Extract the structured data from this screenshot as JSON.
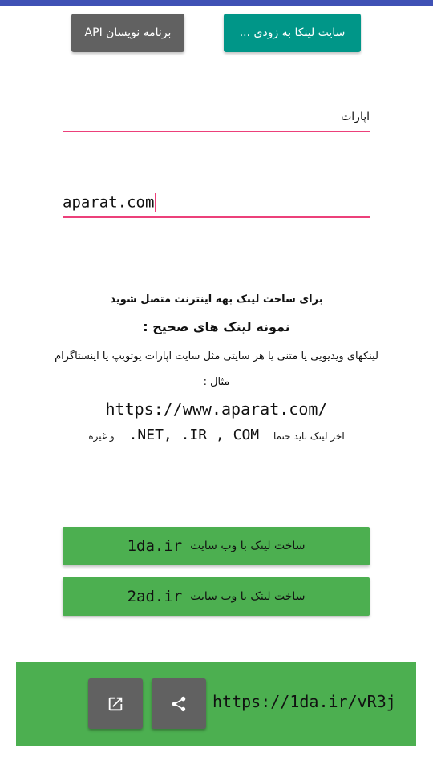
{
  "top_buttons": {
    "api_label": "برنامه نویسان API",
    "coming_soon_label": "سایت لینکا به زودی ..."
  },
  "form": {
    "name_value": "اپارات",
    "url_value": "aparat.com"
  },
  "info": {
    "line1": "برای ساخت لینک بهه اینترنت متصل شوید",
    "line2": "نمونه لینک های صحیح :",
    "line3": "لینکهای ویدیویی یا متنی یا هر سایتی مثل سایت اپارات یوتویپ یا اینستاگرام",
    "line4": "مثال :",
    "example_url": "https://www.aparat.com/",
    "line6_prefix": "اخر لینک باید حتما",
    "line6_ext": ".NET, .IR , COM",
    "line6_suffix": "و غیره"
  },
  "make_buttons": [
    {
      "label": "ساخت لینک با وب سایت",
      "site": "1da.ir"
    },
    {
      "label": "ساخت لینک با وب سایت",
      "site": "2ad.ir"
    }
  ],
  "result": {
    "link": "https://1da.ir/vR3j",
    "open_icon": "open-external-icon",
    "share_icon": "share-icon"
  },
  "colors": {
    "primary": "#3f51b5",
    "teal": "#009688",
    "grey_button": "#616161",
    "green": "#4caf50",
    "accent_pink": "#ec407a"
  }
}
